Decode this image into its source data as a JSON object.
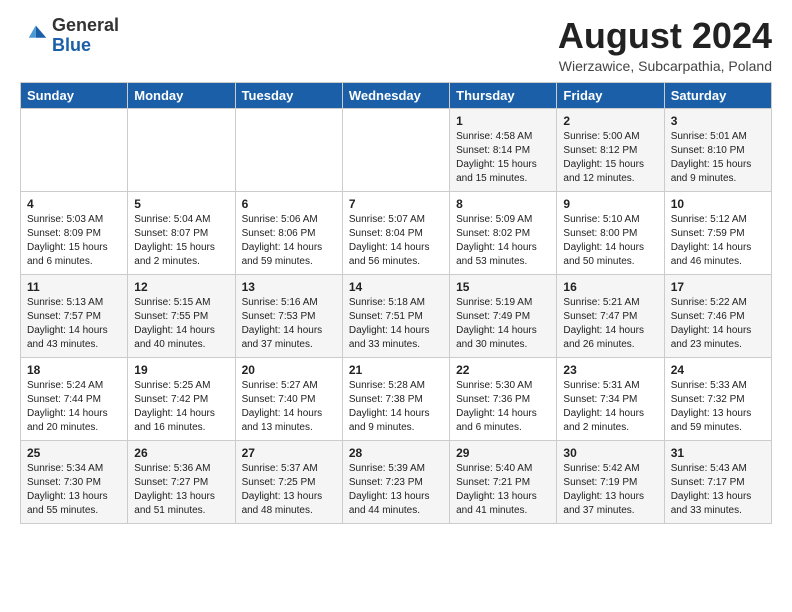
{
  "header": {
    "logo_general": "General",
    "logo_blue": "Blue",
    "month_year": "August 2024",
    "location": "Wierzawice, Subcarpathia, Poland"
  },
  "days_of_week": [
    "Sunday",
    "Monday",
    "Tuesday",
    "Wednesday",
    "Thursday",
    "Friday",
    "Saturday"
  ],
  "weeks": [
    [
      {
        "day": "",
        "info": ""
      },
      {
        "day": "",
        "info": ""
      },
      {
        "day": "",
        "info": ""
      },
      {
        "day": "",
        "info": ""
      },
      {
        "day": "1",
        "info": "Sunrise: 4:58 AM\nSunset: 8:14 PM\nDaylight: 15 hours\nand 15 minutes."
      },
      {
        "day": "2",
        "info": "Sunrise: 5:00 AM\nSunset: 8:12 PM\nDaylight: 15 hours\nand 12 minutes."
      },
      {
        "day": "3",
        "info": "Sunrise: 5:01 AM\nSunset: 8:10 PM\nDaylight: 15 hours\nand 9 minutes."
      }
    ],
    [
      {
        "day": "4",
        "info": "Sunrise: 5:03 AM\nSunset: 8:09 PM\nDaylight: 15 hours\nand 6 minutes."
      },
      {
        "day": "5",
        "info": "Sunrise: 5:04 AM\nSunset: 8:07 PM\nDaylight: 15 hours\nand 2 minutes."
      },
      {
        "day": "6",
        "info": "Sunrise: 5:06 AM\nSunset: 8:06 PM\nDaylight: 14 hours\nand 59 minutes."
      },
      {
        "day": "7",
        "info": "Sunrise: 5:07 AM\nSunset: 8:04 PM\nDaylight: 14 hours\nand 56 minutes."
      },
      {
        "day": "8",
        "info": "Sunrise: 5:09 AM\nSunset: 8:02 PM\nDaylight: 14 hours\nand 53 minutes."
      },
      {
        "day": "9",
        "info": "Sunrise: 5:10 AM\nSunset: 8:00 PM\nDaylight: 14 hours\nand 50 minutes."
      },
      {
        "day": "10",
        "info": "Sunrise: 5:12 AM\nSunset: 7:59 PM\nDaylight: 14 hours\nand 46 minutes."
      }
    ],
    [
      {
        "day": "11",
        "info": "Sunrise: 5:13 AM\nSunset: 7:57 PM\nDaylight: 14 hours\nand 43 minutes."
      },
      {
        "day": "12",
        "info": "Sunrise: 5:15 AM\nSunset: 7:55 PM\nDaylight: 14 hours\nand 40 minutes."
      },
      {
        "day": "13",
        "info": "Sunrise: 5:16 AM\nSunset: 7:53 PM\nDaylight: 14 hours\nand 37 minutes."
      },
      {
        "day": "14",
        "info": "Sunrise: 5:18 AM\nSunset: 7:51 PM\nDaylight: 14 hours\nand 33 minutes."
      },
      {
        "day": "15",
        "info": "Sunrise: 5:19 AM\nSunset: 7:49 PM\nDaylight: 14 hours\nand 30 minutes."
      },
      {
        "day": "16",
        "info": "Sunrise: 5:21 AM\nSunset: 7:47 PM\nDaylight: 14 hours\nand 26 minutes."
      },
      {
        "day": "17",
        "info": "Sunrise: 5:22 AM\nSunset: 7:46 PM\nDaylight: 14 hours\nand 23 minutes."
      }
    ],
    [
      {
        "day": "18",
        "info": "Sunrise: 5:24 AM\nSunset: 7:44 PM\nDaylight: 14 hours\nand 20 minutes."
      },
      {
        "day": "19",
        "info": "Sunrise: 5:25 AM\nSunset: 7:42 PM\nDaylight: 14 hours\nand 16 minutes."
      },
      {
        "day": "20",
        "info": "Sunrise: 5:27 AM\nSunset: 7:40 PM\nDaylight: 14 hours\nand 13 minutes."
      },
      {
        "day": "21",
        "info": "Sunrise: 5:28 AM\nSunset: 7:38 PM\nDaylight: 14 hours\nand 9 minutes."
      },
      {
        "day": "22",
        "info": "Sunrise: 5:30 AM\nSunset: 7:36 PM\nDaylight: 14 hours\nand 6 minutes."
      },
      {
        "day": "23",
        "info": "Sunrise: 5:31 AM\nSunset: 7:34 PM\nDaylight: 14 hours\nand 2 minutes."
      },
      {
        "day": "24",
        "info": "Sunrise: 5:33 AM\nSunset: 7:32 PM\nDaylight: 13 hours\nand 59 minutes."
      }
    ],
    [
      {
        "day": "25",
        "info": "Sunrise: 5:34 AM\nSunset: 7:30 PM\nDaylight: 13 hours\nand 55 minutes."
      },
      {
        "day": "26",
        "info": "Sunrise: 5:36 AM\nSunset: 7:27 PM\nDaylight: 13 hours\nand 51 minutes."
      },
      {
        "day": "27",
        "info": "Sunrise: 5:37 AM\nSunset: 7:25 PM\nDaylight: 13 hours\nand 48 minutes."
      },
      {
        "day": "28",
        "info": "Sunrise: 5:39 AM\nSunset: 7:23 PM\nDaylight: 13 hours\nand 44 minutes."
      },
      {
        "day": "29",
        "info": "Sunrise: 5:40 AM\nSunset: 7:21 PM\nDaylight: 13 hours\nand 41 minutes."
      },
      {
        "day": "30",
        "info": "Sunrise: 5:42 AM\nSunset: 7:19 PM\nDaylight: 13 hours\nand 37 minutes."
      },
      {
        "day": "31",
        "info": "Sunrise: 5:43 AM\nSunset: 7:17 PM\nDaylight: 13 hours\nand 33 minutes."
      }
    ]
  ]
}
